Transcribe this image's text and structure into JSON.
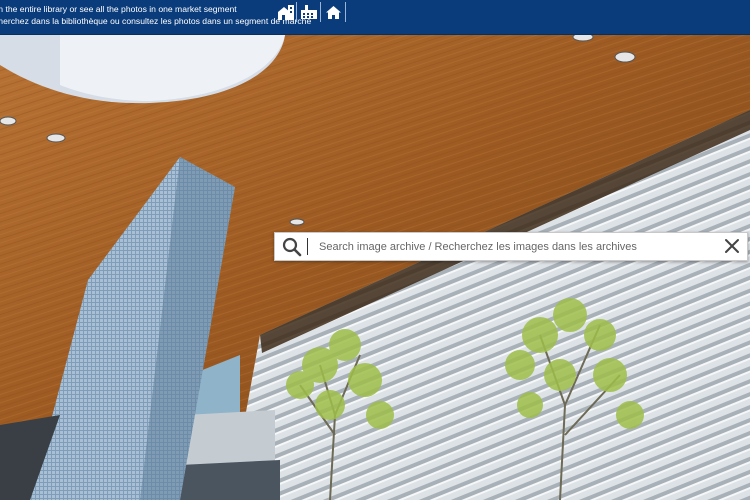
{
  "banner": {
    "line_en": "ch the entire library or see all the photos in one market segment",
    "line_fr": "cherchez dans la bibliothèque ou consultez les photos dans un segment de marché",
    "background": "#0a3c7c",
    "icons": [
      "house-building-icon",
      "factory-icon",
      "home-icon"
    ]
  },
  "search": {
    "placeholder": "Search image archive / Recherchez les images dans les archives",
    "value": "",
    "search_icon": "magnifier-icon",
    "clear_icon": "close-x-icon"
  }
}
